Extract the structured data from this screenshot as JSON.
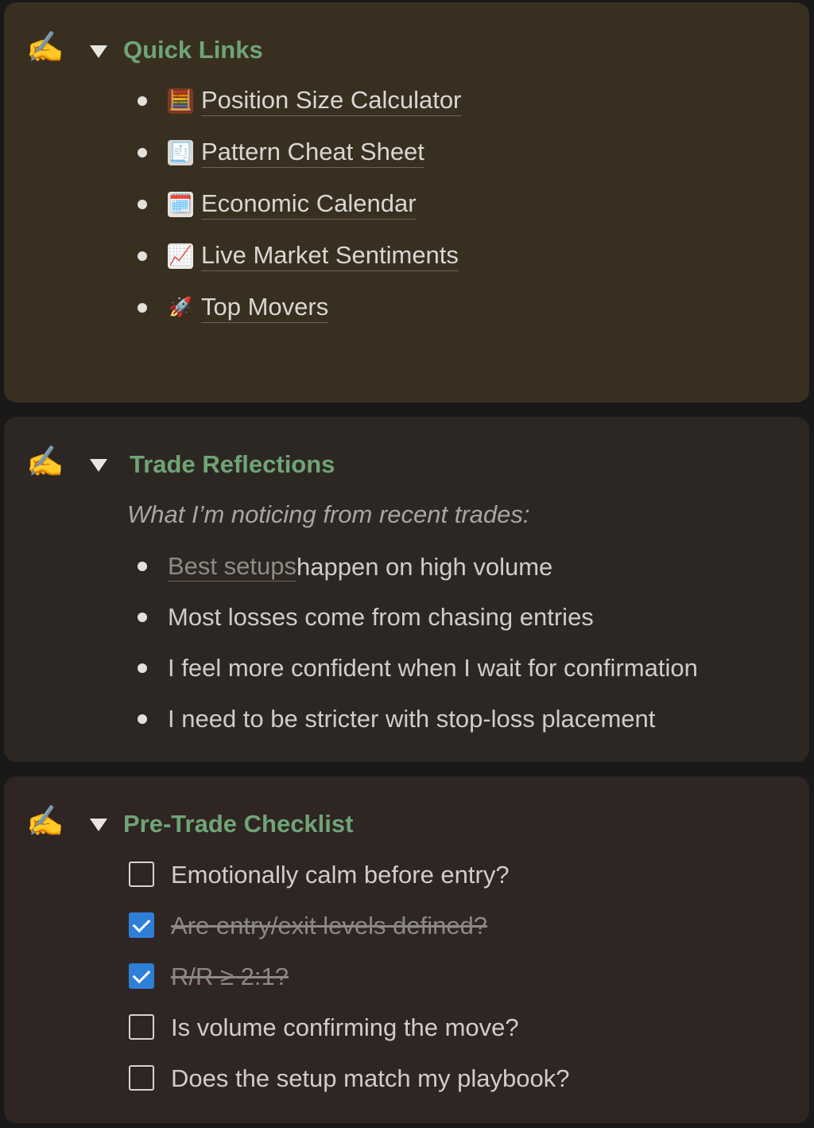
{
  "callouts": [
    {
      "icon": "✍️",
      "title": "Quick Links",
      "links": [
        {
          "emoji": "🧮",
          "label": "Position Size Calculator"
        },
        {
          "emoji": "🧾",
          "label": "Pattern Cheat Sheet"
        },
        {
          "emoji": "🗓️",
          "label": "Economic Calendar"
        },
        {
          "emoji": "📈",
          "label": "Live Market Sentiments"
        },
        {
          "emoji": "🚀",
          "label": "Top Movers"
        }
      ]
    },
    {
      "icon": "✍️",
      "title": "Trade Reflections",
      "intro": "What I’m noticing from recent trades:",
      "items": [
        {
          "link": "Best setups ",
          "text": "happen on high volume"
        },
        {
          "text": "Most losses come from chasing entries"
        },
        {
          "text": "I feel more confident when I wait for confirmation"
        },
        {
          "text": "I need to be stricter with stop-loss placement"
        }
      ]
    },
    {
      "icon": "✍️",
      "title": "Pre-Trade Checklist",
      "checklist": [
        {
          "label": "Emotionally calm before entry?",
          "checked": false
        },
        {
          "label": "Are entry/exit levels defined?",
          "checked": true
        },
        {
          "label": "R/R ≥ 2:1?",
          "checked": true
        },
        {
          "label": "Is volume confirming the move?",
          "checked": false
        },
        {
          "label": "Does the setup match my playbook?",
          "checked": false
        }
      ]
    }
  ],
  "colors": {
    "heading": "#6fa576",
    "callout_1_bg": "#382f21",
    "callout_2_bg": "#2d2724",
    "callout_3_bg": "#2f2523",
    "checkbox_checked": "#2f7fd8"
  }
}
